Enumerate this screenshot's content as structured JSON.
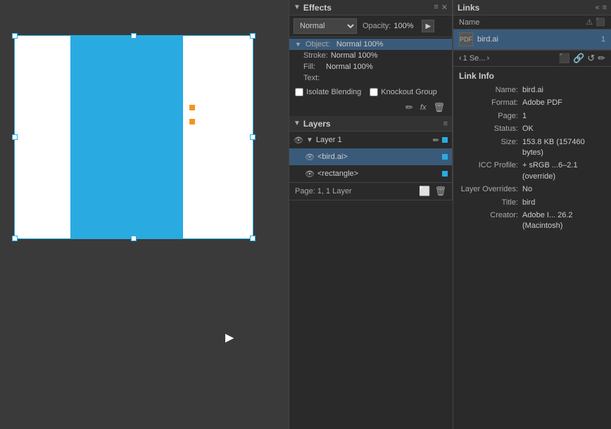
{
  "canvas": {
    "cursor": "▶"
  },
  "effects": {
    "panel_title": "Effects",
    "blend_mode": "Normal",
    "opacity_label": "Opacity:",
    "opacity_value": "100%",
    "object_label": "Object:",
    "object_value": "Normal 100%",
    "stroke_label": "Stroke:",
    "stroke_value": "Normal 100%",
    "fill_label": "Fill:",
    "fill_value": "Normal 100%",
    "text_label": "Text:",
    "isolate_blend_label": "Isolate Blending",
    "knockout_group_label": "Knockout Group"
  },
  "layers": {
    "panel_title": "Layers",
    "items": [
      {
        "name": "Layer 1",
        "type": "group",
        "color": "#29abe2"
      },
      {
        "name": "<bird.ai>",
        "type": "link",
        "color": "#29abe2",
        "highlighted": true
      },
      {
        "name": "<rectangle>",
        "type": "shape",
        "color": "#29abe2"
      }
    ],
    "footer_text": "Page: 1, 1 Layer"
  },
  "links": {
    "panel_title": "Links",
    "name_column": "Name",
    "items": [
      {
        "filename": "bird.ai",
        "page": "1"
      }
    ],
    "toolbar": {
      "label": "1 Se...",
      "icons": [
        "relink",
        "goto",
        "update",
        "edit"
      ]
    },
    "info": {
      "section_title": "Link Info",
      "name_label": "Name:",
      "name_value": "bird.ai",
      "format_label": "Format:",
      "format_value": "Adobe PDF",
      "page_label": "Page:",
      "page_value": "1",
      "status_label": "Status:",
      "status_value": "OK",
      "size_label": "Size:",
      "size_value": "153.8 KB (157460 bytes)",
      "icc_label": "ICC Profile:",
      "icc_value": "+ sRGB ...6–2.1 (override)",
      "layer_overrides_label": "Layer Overrides:",
      "layer_overrides_value": "No",
      "title_label": "Title:",
      "title_value": "bird",
      "creator_label": "Creator:",
      "creator_value": "Adobe I... 26.2 (Macintosh)"
    }
  }
}
